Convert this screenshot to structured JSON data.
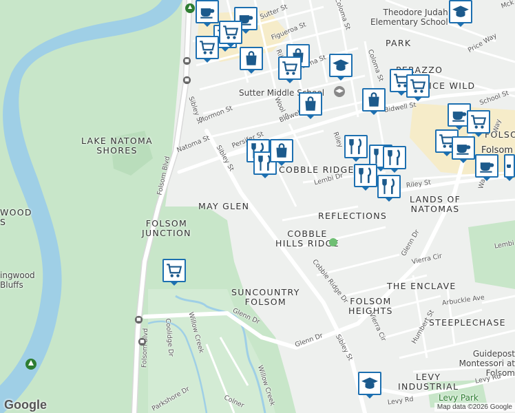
{
  "map": {
    "attribution": "Map data ©2026 Google",
    "logo": "Google",
    "area_labels": [
      {
        "text": "LAKE NATOMA\nSHORES"
      },
      {
        "text": "MAY GLEN"
      },
      {
        "text": "FOLSOM\nJUNCTION"
      },
      {
        "text": "COBBLE RIDGE"
      },
      {
        "text": "REFLECTIONS"
      },
      {
        "text": "COBBLE\nHILLS RIDGE"
      },
      {
        "text": "LANDS OF\nNATOMAS"
      },
      {
        "text": "PARK"
      },
      {
        "text": "PERAZZO"
      },
      {
        "text": "CALICE WILD"
      },
      {
        "text": "THE ENCLAVE"
      },
      {
        "text": "SUNCOUNTRY\nFOLSOM"
      },
      {
        "text": "FOLSOM\nHEIGHTS"
      },
      {
        "text": "STEEPLECHASE"
      },
      {
        "text": "LEVY\nINDUSTRIAL"
      },
      {
        "text": "WOOD\nS"
      },
      {
        "text": "FOLSO"
      },
      {
        "text": "Folsom"
      }
    ],
    "poi_labels": [
      {
        "text": "Theodore Judah\nElementary School"
      },
      {
        "text": "Sutter Middle School"
      },
      {
        "text": "Guidepost\nMontessori at Folsom"
      },
      {
        "text": "Levy Park"
      },
      {
        "text": "ingwood\nBluffs"
      }
    ],
    "street_labels": [
      {
        "text": "Sutter St"
      },
      {
        "text": "Figueroa St"
      },
      {
        "text": "Coloma St"
      },
      {
        "text": "Coloma St"
      },
      {
        "text": "Natoma St"
      },
      {
        "text": "Natoma St"
      },
      {
        "text": "Riley"
      },
      {
        "text": "Mormon St"
      },
      {
        "text": "Sibley St"
      },
      {
        "text": "Sibley St"
      },
      {
        "text": "Sibley St"
      },
      {
        "text": "Persifer St"
      },
      {
        "text": "Wool St"
      },
      {
        "text": "Bidwell St"
      },
      {
        "text": "Bidwell St"
      },
      {
        "text": "Folsom Blvd"
      },
      {
        "text": "Folsom Blvd"
      },
      {
        "text": "Lembi Dr"
      },
      {
        "text": "Lembi Dr"
      },
      {
        "text": "Riley St"
      },
      {
        "text": "Glenn Dr"
      },
      {
        "text": "Glenn Dr"
      },
      {
        "text": "Glenn Dr"
      },
      {
        "text": "Cobble Ridge Dr"
      },
      {
        "text": "Vierra Cir"
      },
      {
        "text": "Vierra Cir"
      },
      {
        "text": "Arbuckle Ave"
      },
      {
        "text": "Humbert St"
      },
      {
        "text": "Levy Rd"
      },
      {
        "text": "Levy Rd"
      },
      {
        "text": "Willow Creek"
      },
      {
        "text": "Willow Creek"
      },
      {
        "text": "Coolidge Dr"
      },
      {
        "text": "Parkshore Dr"
      },
      {
        "text": "Colner"
      },
      {
        "text": "Price Way"
      },
      {
        "text": "School St"
      },
      {
        "text": "Riley"
      },
      {
        "text": "Mck"
      },
      {
        "text": "Wa"
      },
      {
        "text": "Way"
      }
    ],
    "markers": [
      {
        "type": "cafe"
      },
      {
        "type": "cafe"
      },
      {
        "type": "grocery"
      },
      {
        "type": "grocery"
      },
      {
        "type": "grocery"
      },
      {
        "type": "shopping"
      },
      {
        "type": "shopping"
      },
      {
        "type": "grocery"
      },
      {
        "type": "school"
      },
      {
        "type": "school"
      },
      {
        "type": "grocery"
      },
      {
        "type": "grocery"
      },
      {
        "type": "shopping"
      },
      {
        "type": "shopping"
      },
      {
        "type": "restaurant"
      },
      {
        "type": "restaurant"
      },
      {
        "type": "shopping"
      },
      {
        "type": "restaurant"
      },
      {
        "type": "restaurant"
      },
      {
        "type": "restaurant"
      },
      {
        "type": "restaurant"
      },
      {
        "type": "restaurant"
      },
      {
        "type": "cafe"
      },
      {
        "type": "grocery"
      },
      {
        "type": "grocery"
      },
      {
        "type": "cafe"
      },
      {
        "type": "cafe"
      },
      {
        "type": "cafe"
      },
      {
        "type": "grocery"
      },
      {
        "type": "school"
      }
    ],
    "colors": {
      "land": "#eef0ee",
      "park": "#c8e6c9",
      "water": "#9fcfe6",
      "road": "#ffffff",
      "major_road": "#d9d9d9",
      "commercial": "#f6ecc9",
      "marker_border": "#1c6fb0",
      "marker_icon": "#1c5a8c"
    }
  }
}
